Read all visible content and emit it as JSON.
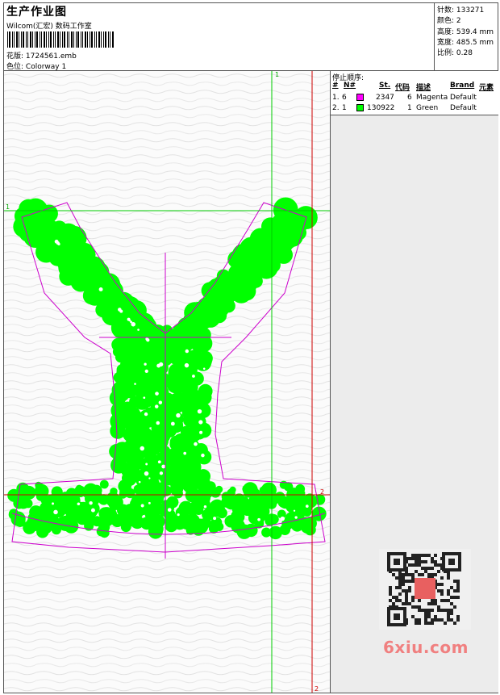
{
  "header": {
    "title": "生产作业图",
    "subtitle": "Wilcom(汇宏) 数码工作室",
    "file_label": "花版:",
    "file_value": "1724561.emb",
    "colorway_label": "色位:",
    "colorway_value": "Colorway 1"
  },
  "stats": {
    "stitches": "针数: 133271",
    "colors": "颜色: 2",
    "height": "高度: 539.4 mm",
    "width": "宽度: 485.5 mm",
    "scale": "比例: 0.28"
  },
  "sequence": {
    "title": "停止顺序:",
    "columns": [
      "#",
      "N#",
      "St.",
      "代码",
      "描述",
      "Brand",
      "元素"
    ],
    "rows": [
      {
        "num": "1.",
        "needle": "6",
        "color": "#ff00ff",
        "stitches": "2347",
        "code": "6",
        "desc": "Magenta",
        "brand": "Default"
      },
      {
        "num": "2.",
        "needle": "1",
        "color": "#00ff00",
        "stitches": "130922",
        "code": "1",
        "desc": "Green",
        "brand": "Default"
      }
    ]
  },
  "guides": {
    "v1_label": "1",
    "h1_label": "1",
    "h2_label": "2",
    "v2_label": "2"
  },
  "watermark": {
    "text": "6xiu.com"
  },
  "colors": {
    "green": "#00ff00",
    "magenta": "#cc00cc",
    "guide_green": "#00cc00",
    "guide_red": "#cc0000"
  }
}
